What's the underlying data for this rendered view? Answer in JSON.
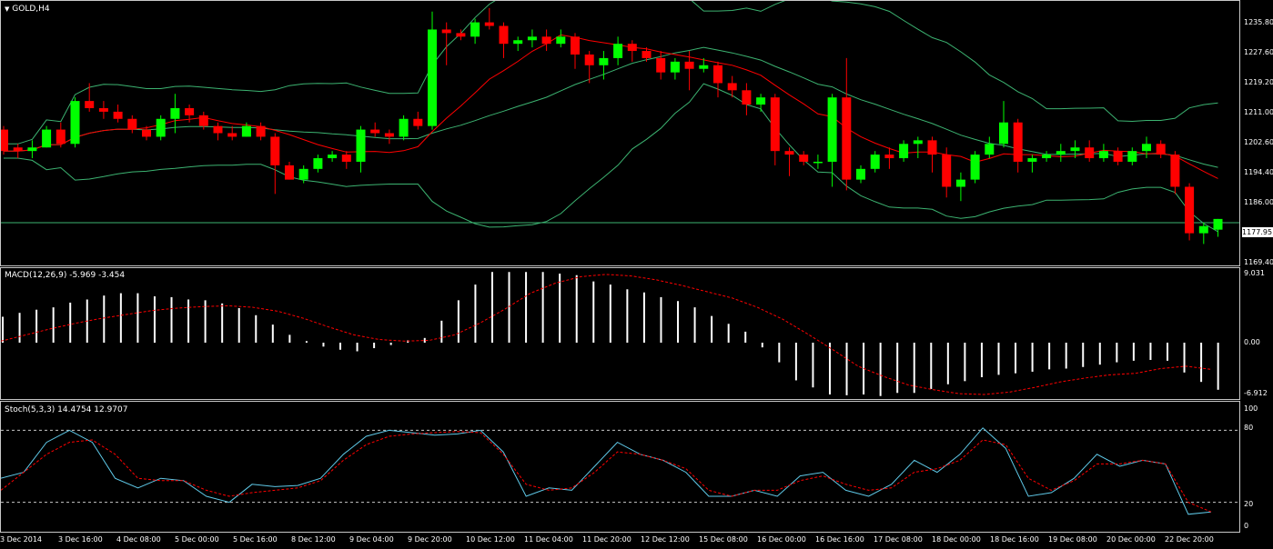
{
  "title": {
    "arrow": "▼",
    "text": "GOLD,H4"
  },
  "macd_label": "MACD(12,26,9) -5.969 -3.454",
  "stoch_label": "Stoch(5,3,3) 14.4754 12.9707",
  "price_axis": [
    "1235.80",
    "1227.60",
    "1219.20",
    "1211.00",
    "1202.60",
    "1194.40",
    "1186.00",
    "1169.40"
  ],
  "current_price": "1177.95",
  "macd_axis": [
    "9.031",
    "0.00",
    "-6.912"
  ],
  "stoch_axis": [
    "100",
    "80",
    "20",
    "0"
  ],
  "time_axis": [
    "3 Dec 2014",
    "3 Dec 16:00",
    "4 Dec 08:00",
    "5 Dec 00:00",
    "5 Dec 16:00",
    "8 Dec 12:00",
    "9 Dec 04:00",
    "9 Dec 20:00",
    "10 Dec 12:00",
    "11 Dec 04:00",
    "11 Dec 20:00",
    "12 Dec 12:00",
    "15 Dec 08:00",
    "16 Dec 00:00",
    "16 Dec 16:00",
    "17 Dec 08:00",
    "18 Dec 00:00",
    "18 Dec 16:00",
    "19 Dec 08:00",
    "20 Dec 00:00",
    "22 Dec 20:00"
  ],
  "colors": {
    "bull": "#00ff00",
    "bear": "#ff0000",
    "band": "#3cb371",
    "ma": "#ff0000",
    "stoch_main": "#5fc9e8",
    "stoch_signal": "#ff0000"
  },
  "chart_data": {
    "type": "candlestick",
    "symbol": "GOLD",
    "timeframe": "H4",
    "ylim": [
      1166,
      1240
    ],
    "candles": [
      [
        1204,
        1205,
        1197,
        1198
      ],
      [
        1199,
        1200,
        1196,
        1198
      ],
      [
        1198,
        1201,
        1196,
        1199
      ],
      [
        1199,
        1205,
        1199,
        1204
      ],
      [
        1204,
        1206,
        1199,
        1200
      ],
      [
        1200,
        1213,
        1199,
        1212
      ],
      [
        1212,
        1217,
        1209,
        1210
      ],
      [
        1210,
        1212,
        1207,
        1209
      ],
      [
        1209,
        1211,
        1206,
        1207
      ],
      [
        1207,
        1208,
        1203,
        1204
      ],
      [
        1204,
        1205,
        1201,
        1202
      ],
      [
        1202,
        1208,
        1201,
        1207
      ],
      [
        1207,
        1214,
        1203,
        1210
      ],
      [
        1210,
        1211,
        1206,
        1208
      ],
      [
        1208,
        1209,
        1204,
        1205
      ],
      [
        1205,
        1206,
        1201,
        1203
      ],
      [
        1203,
        1205,
        1201,
        1202
      ],
      [
        1202,
        1206,
        1202,
        1205
      ],
      [
        1205,
        1206,
        1201,
        1202
      ],
      [
        1202,
        1203,
        1186,
        1194
      ],
      [
        1194,
        1195,
        1190,
        1190
      ],
      [
        1190,
        1194,
        1189,
        1193
      ],
      [
        1193,
        1197,
        1192,
        1196
      ],
      [
        1196,
        1198,
        1195,
        1197
      ],
      [
        1197,
        1198,
        1193,
        1195
      ],
      [
        1195,
        1205,
        1192,
        1204
      ],
      [
        1204,
        1206,
        1202,
        1203
      ],
      [
        1203,
        1204,
        1200,
        1202
      ],
      [
        1202,
        1208,
        1201,
        1207
      ],
      [
        1207,
        1209,
        1204,
        1205
      ],
      [
        1205,
        1237,
        1204,
        1232
      ],
      [
        1232,
        1234,
        1222,
        1231
      ],
      [
        1231,
        1232,
        1229,
        1230
      ],
      [
        1230,
        1235,
        1228,
        1234
      ],
      [
        1234,
        1238,
        1232,
        1233
      ],
      [
        1233,
        1234,
        1224,
        1228
      ],
      [
        1228,
        1230,
        1226,
        1229
      ],
      [
        1229,
        1232,
        1227,
        1230
      ],
      [
        1230,
        1232,
        1226,
        1228
      ],
      [
        1228,
        1232,
        1227,
        1230
      ],
      [
        1230,
        1231,
        1221,
        1225
      ],
      [
        1225,
        1226,
        1217,
        1222
      ],
      [
        1222,
        1226,
        1218,
        1224
      ],
      [
        1224,
        1230,
        1222,
        1228
      ],
      [
        1228,
        1229,
        1223,
        1226
      ],
      [
        1226,
        1227,
        1223,
        1224
      ],
      [
        1224,
        1226,
        1218,
        1220
      ],
      [
        1220,
        1224,
        1218,
        1223
      ],
      [
        1223,
        1226,
        1215,
        1221
      ],
      [
        1221,
        1224,
        1220,
        1222
      ],
      [
        1222,
        1223,
        1213,
        1217
      ],
      [
        1217,
        1219,
        1213,
        1215
      ],
      [
        1215,
        1217,
        1208,
        1211
      ],
      [
        1211,
        1214,
        1209,
        1213
      ],
      [
        1213,
        1214,
        1194,
        1198
      ],
      [
        1198,
        1199,
        1191,
        1197
      ],
      [
        1197,
        1198,
        1194,
        1195
      ],
      [
        1195,
        1197,
        1193,
        1195
      ],
      [
        1195,
        1214,
        1188,
        1213
      ],
      [
        1213,
        1224,
        1187,
        1190
      ],
      [
        1190,
        1194,
        1189,
        1193
      ],
      [
        1193,
        1198,
        1192,
        1197
      ],
      [
        1197,
        1199,
        1193,
        1196
      ],
      [
        1196,
        1201,
        1195,
        1200
      ],
      [
        1200,
        1202,
        1196,
        1201
      ],
      [
        1201,
        1202,
        1192,
        1197
      ],
      [
        1197,
        1199,
        1185,
        1188
      ],
      [
        1188,
        1192,
        1184,
        1190
      ],
      [
        1190,
        1198,
        1189,
        1197
      ],
      [
        1197,
        1202,
        1196,
        1200
      ],
      [
        1200,
        1212,
        1199,
        1206
      ],
      [
        1206,
        1207,
        1192,
        1195
      ],
      [
        1195,
        1197,
        1192,
        1196
      ],
      [
        1196,
        1198,
        1195,
        1197
      ],
      [
        1197,
        1200,
        1195,
        1198
      ],
      [
        1198,
        1201,
        1196,
        1199
      ],
      [
        1199,
        1201,
        1195,
        1196
      ],
      [
        1196,
        1200,
        1195,
        1198
      ],
      [
        1198,
        1199,
        1194,
        1195
      ],
      [
        1195,
        1199,
        1194,
        1198
      ],
      [
        1198,
        1202,
        1196,
        1200
      ],
      [
        1200,
        1201,
        1196,
        1197
      ],
      [
        1197,
        1198,
        1186,
        1188
      ],
      [
        1188,
        1189,
        1173,
        1175
      ],
      [
        1175,
        1178,
        1172,
        1177
      ],
      [
        1176,
        1179,
        1174,
        1179
      ]
    ],
    "macd_hist": [
      3.3,
      3.8,
      4.2,
      4.5,
      5.1,
      5.5,
      6.0,
      6.3,
      6.3,
      5.9,
      5.8,
      5.5,
      5.4,
      5.0,
      4.4,
      3.5,
      2.3,
      1.0,
      0.2,
      -0.5,
      -0.9,
      -1.1,
      -0.7,
      -0.3,
      0.3,
      0.6,
      2.8,
      5.4,
      7.4,
      9.0,
      9.0,
      9.0,
      9.0,
      8.8,
      8.6,
      7.8,
      7.4,
      6.8,
      6.4,
      5.8,
      5.3,
      4.5,
      3.4,
      2.4,
      1.4,
      -0.6,
      -2.5,
      -4.8,
      -5.7,
      -6.6,
      -6.7,
      -6.6,
      -6.8,
      -6.4,
      -6.4,
      -5.9,
      -5.3,
      -4.9,
      -4.4,
      -4.1,
      -3.9,
      -3.7,
      -3.4,
      -3.3,
      -3.1,
      -2.8,
      -2.5,
      -2.3,
      -2.2,
      -2.3,
      -3.8,
      -5.0,
      -6.0
    ],
    "macd_signal": [
      0.2,
      1.0,
      1.8,
      2.5,
      3.1,
      3.6,
      4.1,
      4.4,
      4.6,
      4.7,
      4.5,
      4.0,
      3.1,
      2.0,
      1.0,
      0.4,
      0.2,
      0.3,
      1.0,
      2.5,
      4.3,
      6.3,
      7.6,
      8.4,
      8.7,
      8.5,
      8.0,
      7.3,
      6.5,
      5.7,
      4.5,
      3.0,
      1.1,
      -0.9,
      -3.0,
      -4.3,
      -5.4,
      -6.0,
      -6.5,
      -6.6,
      -6.3,
      -5.7,
      -5.0,
      -4.5,
      -4.1,
      -3.9,
      -3.3,
      -3.0,
      -3.4
    ],
    "stoch_main": [
      40,
      45,
      70,
      80,
      70,
      40,
      32,
      40,
      38,
      25,
      20,
      35,
      33,
      34,
      40,
      60,
      75,
      80,
      78,
      76,
      77,
      80,
      62,
      25,
      32,
      30,
      50,
      70,
      60,
      55,
      45,
      25,
      25,
      30,
      25,
      42,
      45,
      30,
      25,
      35,
      55,
      45,
      60,
      82,
      65,
      25,
      28,
      40,
      60,
      50,
      55,
      52,
      10,
      12
    ],
    "stoch_signal": [
      30,
      45,
      60,
      70,
      72,
      60,
      40,
      38,
      38,
      30,
      25,
      28,
      30,
      32,
      38,
      55,
      68,
      75,
      77,
      78,
      79,
      78,
      60,
      35,
      30,
      32,
      45,
      62,
      60,
      55,
      48,
      30,
      25,
      30,
      30,
      38,
      42,
      35,
      30,
      32,
      45,
      48,
      55,
      72,
      68,
      40,
      30,
      38,
      52,
      52,
      55,
      52,
      20,
      12
    ],
    "stoch_levels": [
      80,
      20
    ]
  }
}
